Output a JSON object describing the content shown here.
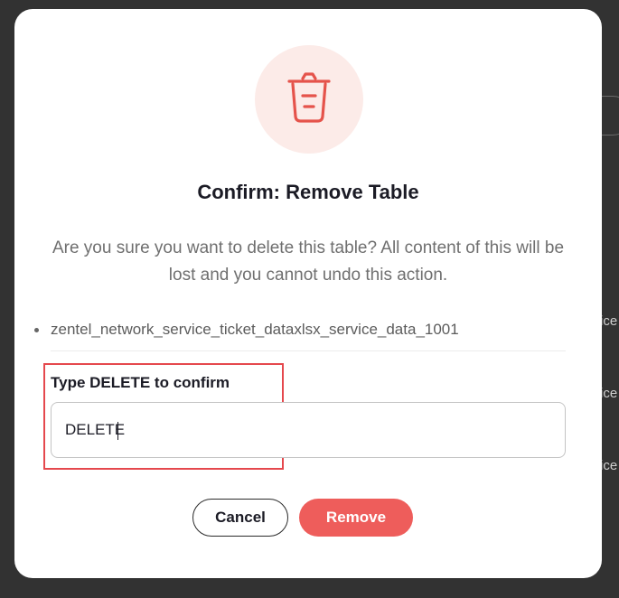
{
  "background": {
    "fragments": [
      "ice",
      "ice",
      "ice"
    ]
  },
  "dialog": {
    "icon": "trash-icon",
    "title": "Confirm: Remove Table",
    "message": "Are you sure you want to delete this table? All content of this will be lost and you cannot undo this action.",
    "tables": [
      "zentel_network_service_ticket_dataxlsx_service_data_1001"
    ],
    "confirm_label": "Type DELETE to confirm",
    "confirm_value": "DELETE",
    "cancel_label": "Cancel",
    "remove_label": "Remove"
  },
  "colors": {
    "accent_red": "#ee5d5b",
    "icon_bg": "#fcebe8",
    "highlight": "#e5484d",
    "overlay": "#323232"
  }
}
